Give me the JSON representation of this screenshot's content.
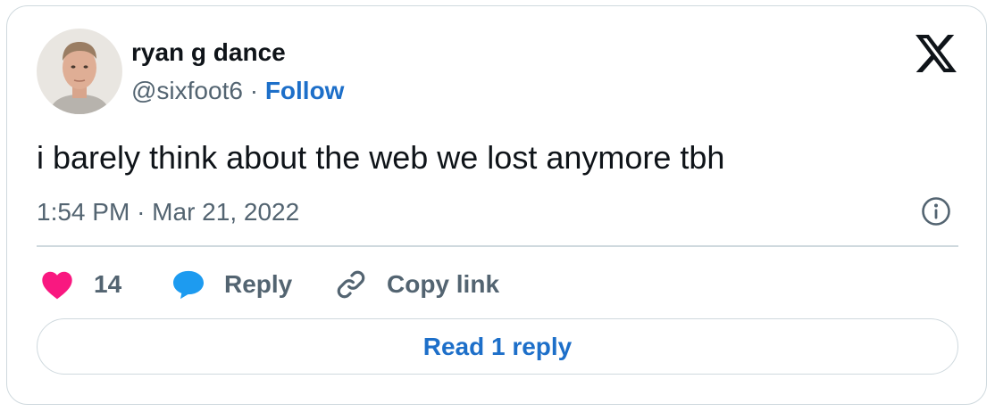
{
  "author": {
    "display_name": "ryan g dance",
    "handle": "@sixfoot6",
    "separator": "·",
    "follow_label": "Follow",
    "avatar_icon": "profile-photo"
  },
  "brand": {
    "logo_icon": "x-logo-icon"
  },
  "tweet": {
    "text": "i barely think about the web we lost anymore tbh",
    "time": "1:54 PM",
    "separator": "·",
    "date": "Mar 21, 2022",
    "info_icon": "info-icon"
  },
  "actions": {
    "like": {
      "icon": "heart-icon",
      "count": "14"
    },
    "reply": {
      "icon": "speech-bubble-icon",
      "label": "Reply"
    },
    "copy": {
      "icon": "link-icon",
      "label": "Copy link"
    }
  },
  "read_replies": {
    "label": "Read 1 reply"
  },
  "colors": {
    "text": "#0f1419",
    "secondary": "#536471",
    "link": "#1d6fc9",
    "heart": "#f91880",
    "reply_bubble": "#1d9bf0",
    "border": "#cfd9de"
  }
}
